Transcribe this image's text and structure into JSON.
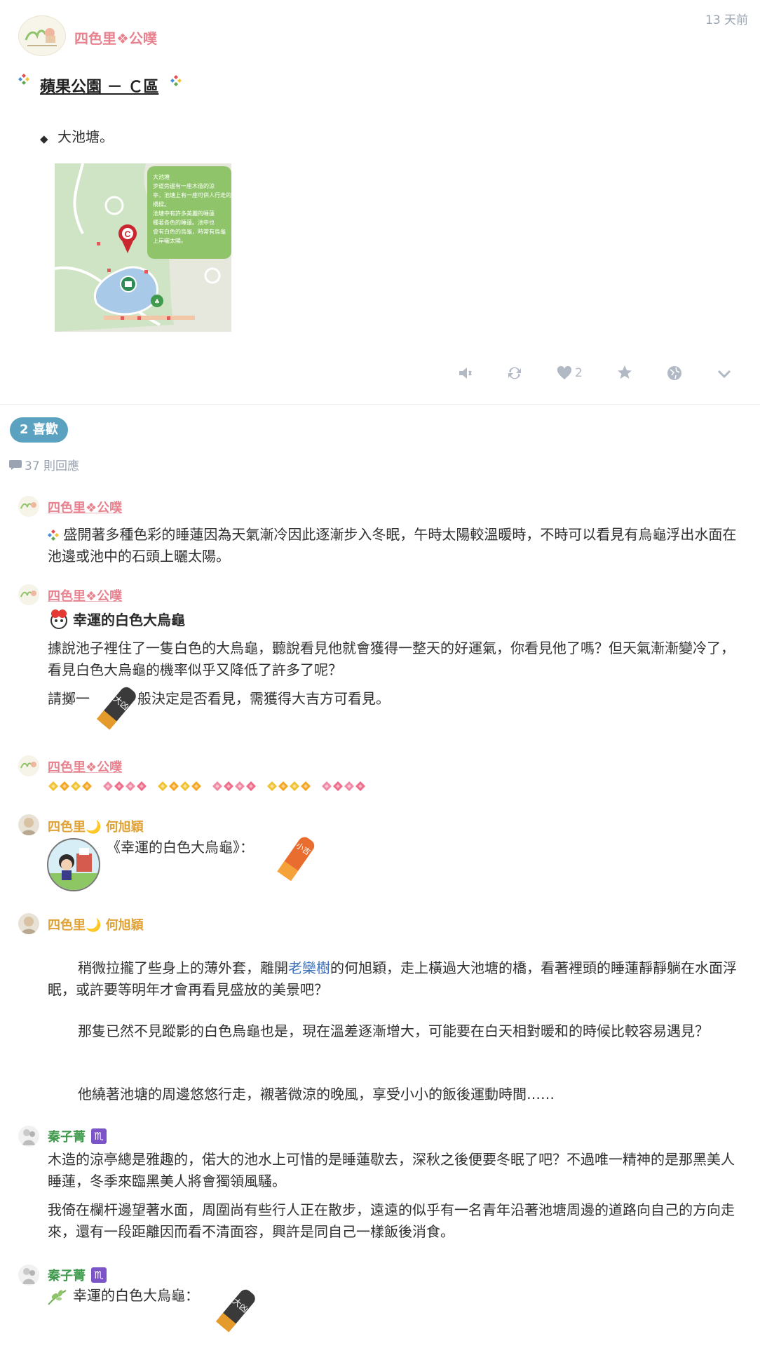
{
  "post": {
    "author": "四色里❖公噗",
    "timestamp": "13 天前",
    "title": "蘋果公園 － Ｃ區",
    "bullet_text": "大池塘。",
    "map_marker_label": "C",
    "map_caption_lines": [
      "大池塘",
      "步道旁邊有一座木造的涼",
      "亭，池塘上有一座可供人行走的",
      "橋樑。",
      "池塘中有許多美麗的睡蓮",
      "種著各色的睡蓮。池中也",
      "會有白色的烏龜，時常有烏龜",
      "上岸曬太陽。"
    ],
    "like_count": "2"
  },
  "likes_pill": "2 喜歡",
  "reply_count": "37 則回應",
  "responses": [
    {
      "author": "四色里❖公噗",
      "paragraphs": [
        "盛開著多種色彩的睡蓮因為天氣漸冷因此逐漸步入冬眠，午時太陽較溫暖時，不時可以看見有烏龜浮出水面在池邊或池中的石頭上曬太陽。"
      ]
    },
    {
      "author": "四色里❖公噗",
      "heading": "幸運的白色大烏龜",
      "paragraphs": [
        "據說池子裡住了一隻白色的大烏龜，聽說看見他就會獲得一整天的好運氣，你看見他了嗎？但天氣漸漸變冷了，看見白色大烏龜的機率似乎又降低了許多了呢？"
      ],
      "dice_before": "請擲一",
      "dice_after": "般決定是否看見，需獲得大吉方可看見。",
      "dice_label": "大凶"
    },
    {
      "author": "四色里❖公噗",
      "diamond_groups": 6
    },
    {
      "author": "四色里🌙 何旭穎",
      "quote": "《幸運的白色大烏龜》：",
      "dice_label": "小吉"
    },
    {
      "author": "四色里🌙 何旭穎",
      "p1_a": "稍微拉攏了些身上的薄外套，離開",
      "p1_link": "老欒樹",
      "p1_b": "的何旭穎，走上橫過大池塘的橋，看著裡頭的睡蓮靜靜躺在水面浮眠，或許要等明年才會再看見盛放的美景吧？",
      "p2": "那隻已然不見蹤影的白色烏龜也是，現在溫差逐漸增大，可能要在白天相對暖和的時候比較容易遇見？",
      "p3": "他繞著池塘的周邊悠悠行走，襯著微涼的晚風，享受小小的飯後運動時間……"
    },
    {
      "author": "秦子菁",
      "badge": "♏",
      "paragraphs": [
        "木造的涼亭總是雅趣的，偌大的池水上可惜的是睡蓮歇去，深秋之後便要冬眠了吧？不過唯一精神的是那黑美人睡蓮，冬季來臨黑美人將會獨領風騷。",
        "我倚在欄杆邊望著水面，周圍尚有些行人正在散步，遠遠的似乎有一名青年沿著池塘周邊的道路向自己的方向走來，還有一段距離因而看不清面容，興許是同自己一樣飯後消食。"
      ]
    },
    {
      "author": "秦子菁",
      "badge": "♏",
      "quote": "幸運的白色大烏龜：",
      "dice_label": "大凶"
    }
  ],
  "colors": {
    "brand_pink": "#e8828f",
    "orange_name": "#e0a135",
    "green_name": "#3f9a4c",
    "pill_blue": "#5ba1c0",
    "icon_grey": "#b1b9c5"
  }
}
